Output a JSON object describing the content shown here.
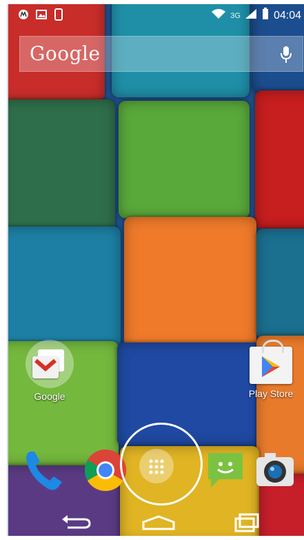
{
  "status_bar": {
    "network_label": "3G",
    "time": "04:04",
    "icons": [
      "motorola-icon",
      "image-icon",
      "phone-outline-icon",
      "wifi-icon",
      "signal-icon",
      "battery-icon"
    ]
  },
  "search_bar": {
    "brand_text": "Google",
    "mic_icon": "mic-icon"
  },
  "home_apps": [
    {
      "label": "Google",
      "icon": "google-folder-icon"
    },
    {
      "label": "Play Store",
      "icon": "play-store-icon"
    }
  ],
  "dock": [
    {
      "name": "Phone",
      "icon": "phone-icon"
    },
    {
      "name": "Chrome",
      "icon": "chrome-icon"
    },
    {
      "name": "Apps",
      "icon": "app-drawer-icon"
    },
    {
      "name": "Messaging",
      "icon": "messaging-icon"
    },
    {
      "name": "Camera",
      "icon": "camera-icon"
    }
  ],
  "nav": [
    "back-icon",
    "home-icon",
    "recents-icon"
  ],
  "colors": {
    "accent": "#ffffff",
    "brick_teal": "#1f8fa8",
    "brick_green": "#5fae3e",
    "brick_orange": "#f0782a",
    "brick_red": "#d8252a",
    "brick_blue": "#1f4aa0"
  }
}
